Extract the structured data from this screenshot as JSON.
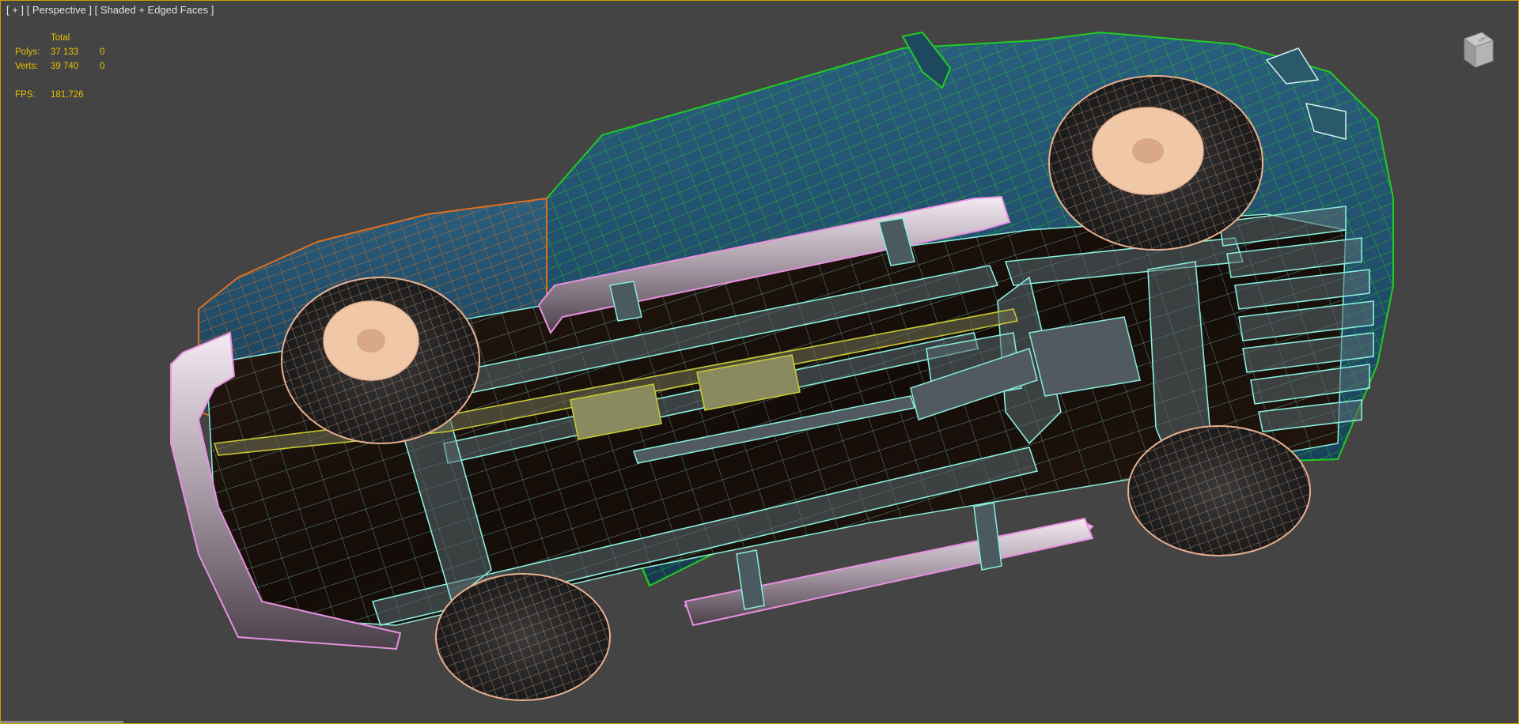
{
  "viewport": {
    "menu_plus": "[ + ]",
    "view_name": "[ Perspective ]",
    "shading_mode": "[ Shaded + Edged Faces ]"
  },
  "stats": {
    "header": "Total",
    "polys_label": "Polys:",
    "polys_total": "37 133",
    "polys_selected": "0",
    "verts_label": "Verts:",
    "verts_total": "39 740",
    "verts_selected": "0",
    "fps_label": "FPS:",
    "fps_value": "181,726"
  },
  "viewcube": {
    "face_label": "LEFT"
  },
  "colors": {
    "background": "#444444",
    "stats_text": "#e6c200",
    "label_text": "#e2e2e2",
    "active_border": "#c8a000",
    "wire_green": "#22cc22",
    "wire_orange": "#e07020",
    "wire_cyan": "#88eedd",
    "wire_pink": "#e890e0",
    "wire_tan": "#e8b090",
    "wire_yellow": "#c8c830",
    "body_blue": "#1f4a66"
  }
}
